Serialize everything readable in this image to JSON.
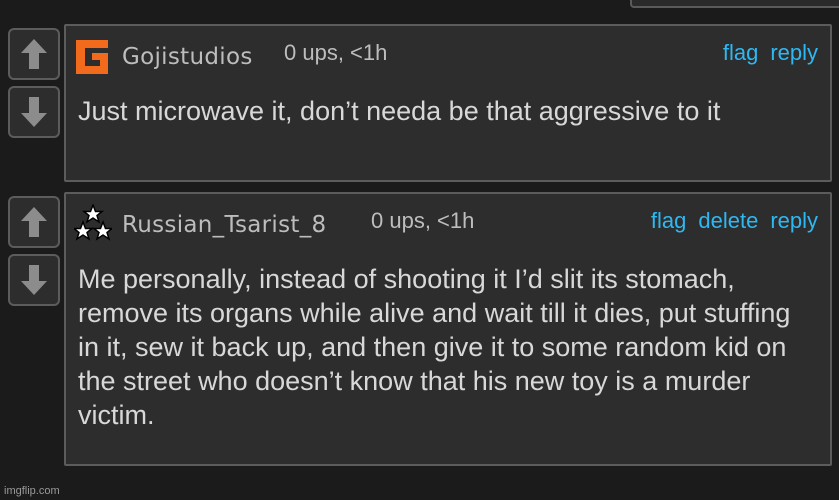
{
  "comments": [
    {
      "username": "Gojistudios",
      "meta": "0 ups, <1h",
      "avatar_icon": "orange-g-logo-icon",
      "actions": [
        "flag",
        "reply"
      ],
      "body": "Just microwave it, don’t needa be that aggressive to it"
    },
    {
      "username": "Russian_Tsarist_8",
      "meta": "0 ups, <1h",
      "avatar_icon": "three-stars-icon",
      "actions": [
        "flag",
        "delete",
        "reply"
      ],
      "body": "Me personally, instead of shooting it I’d slit its stomach, remove its organs while alive and wait till it dies, put stuffing in it, sew it back up, and then give it to some random kid on the street who doesn’t know that his new toy is a murder victim."
    }
  ],
  "icons": {
    "upvote": "up-arrow-icon",
    "downvote": "down-arrow-icon"
  },
  "colors": {
    "background": "#1b1b1b",
    "panel": "#2d2d2d",
    "border": "#5c5c5c",
    "link": "#2eb8f2",
    "text": "#d8d8d8",
    "avatar_orange": "#f26a1b"
  },
  "watermark": "imgflip.com"
}
